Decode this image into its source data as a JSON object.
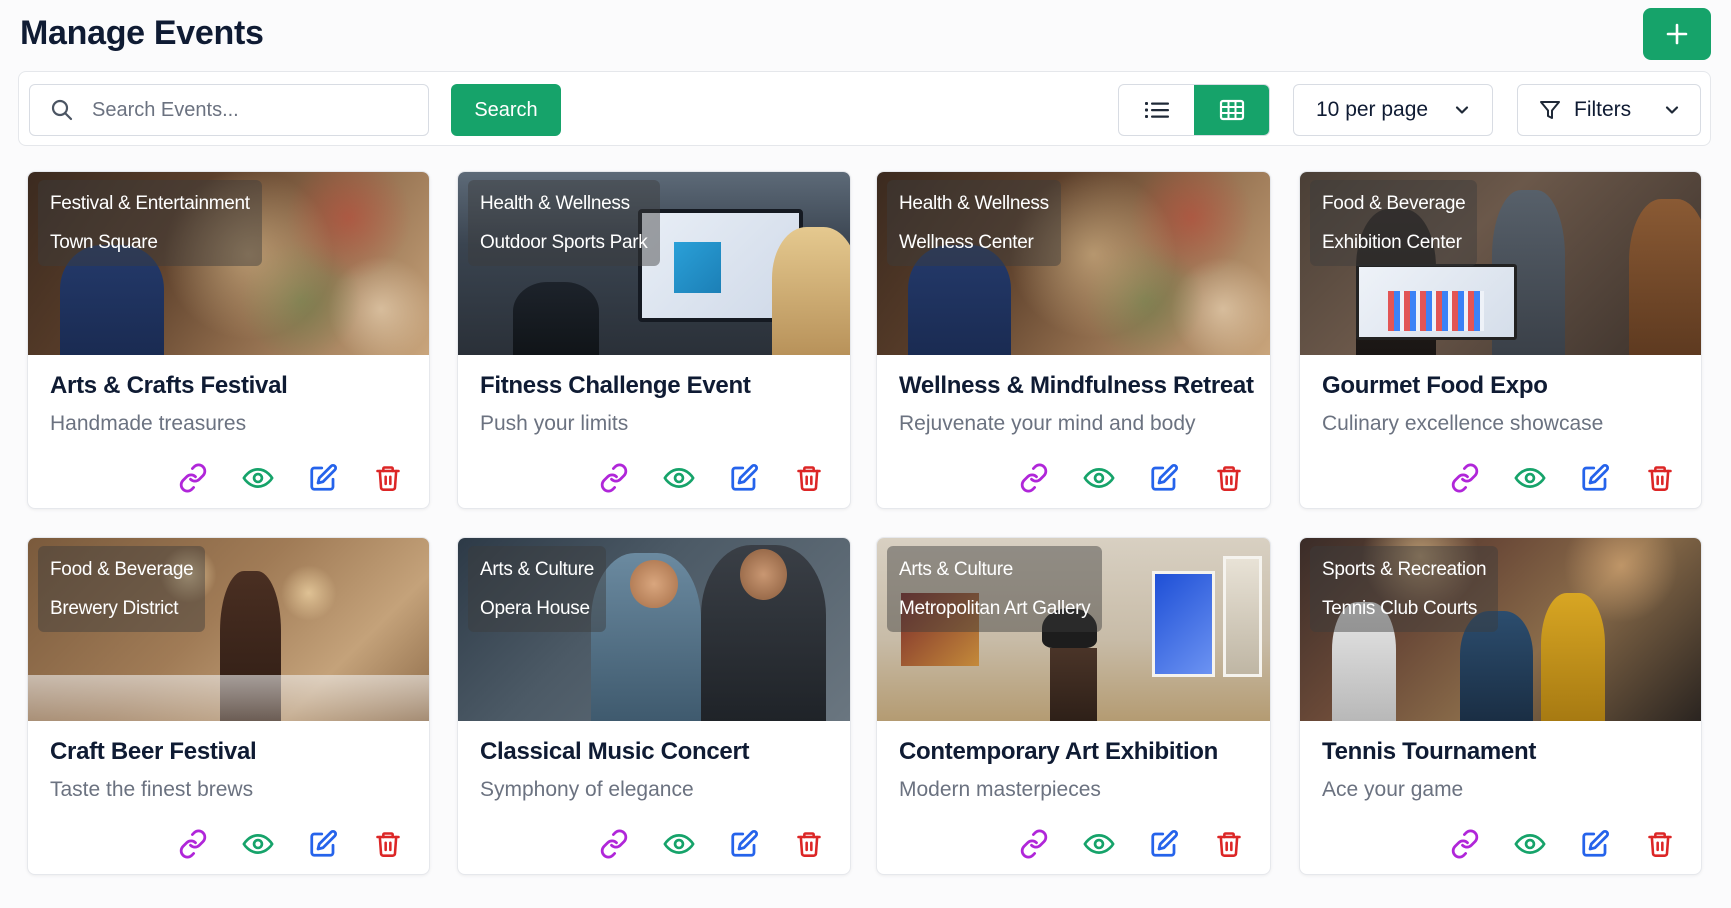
{
  "header": {
    "title": "Manage Events"
  },
  "toolbar": {
    "search_placeholder": "Search Events...",
    "search_button": "Search",
    "per_page": "10 per page",
    "filters": "Filters"
  },
  "colors": {
    "accent": "#16a36a",
    "link": "#b026d9",
    "view": "#16a36a",
    "edit": "#2563eb",
    "delete": "#dc2626"
  },
  "events": [
    {
      "category": "Festival & Entertainment",
      "venue": "Town Square",
      "title": "Arts & Crafts Festival",
      "subtitle": "Handmade treasures",
      "scene": "food-table"
    },
    {
      "category": "Health & Wellness",
      "venue": "Outdoor Sports Park",
      "title": "Fitness Challenge Event",
      "subtitle": "Push your limits",
      "scene": "screen-office"
    },
    {
      "category": "Health & Wellness",
      "venue": "Wellness Center",
      "title": "Wellness & Mindfulness Retreat",
      "subtitle": "Rejuvenate your mind and body",
      "scene": "food-table"
    },
    {
      "category": "Food & Beverage",
      "venue": "Exhibition Center",
      "title": "Gourmet Food Expo",
      "subtitle": "Culinary excellence showcase",
      "scene": "laptop-meeting"
    },
    {
      "category": "Food & Beverage",
      "venue": "Brewery District",
      "title": "Craft Beer Festival",
      "subtitle": "Taste the finest brews",
      "scene": "brewery"
    },
    {
      "category": "Arts & Culture",
      "venue": "Opera House",
      "title": "Classical Music Concert",
      "subtitle": "Symphony of elegance",
      "scene": "handshake"
    },
    {
      "category": "Arts & Culture",
      "venue": "Metropolitan Art Gallery",
      "title": "Contemporary Art Exhibition",
      "subtitle": "Modern masterpieces",
      "scene": "gallery"
    },
    {
      "category": "Sports & Recreation",
      "venue": "Tennis Club Courts",
      "title": "Tennis Tournament",
      "subtitle": "Ace your game",
      "scene": "crowd"
    }
  ]
}
